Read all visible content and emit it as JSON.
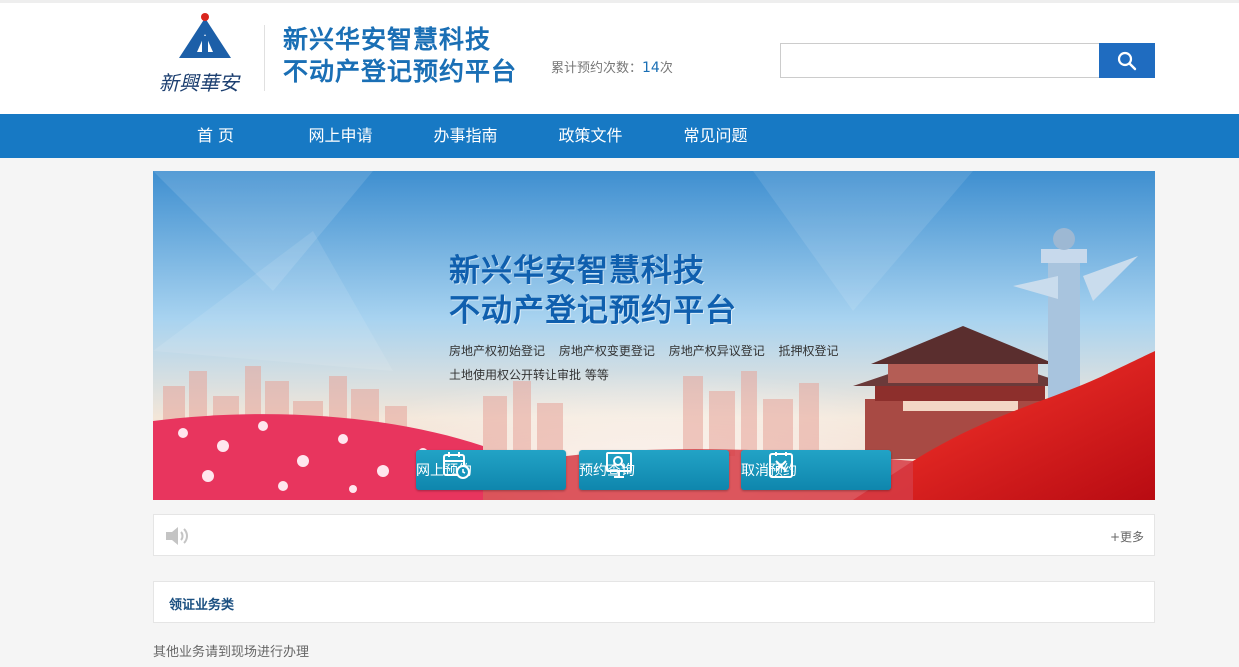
{
  "header": {
    "logo_text": "新興華安",
    "title_line1": "新兴华安智慧科技",
    "title_line2": "不动产登记预约平台",
    "counter_label": "累计预约次数：",
    "counter_value": "14",
    "counter_unit": "次",
    "search_value": ""
  },
  "nav": {
    "items": [
      "首 页",
      "网上申请",
      "办事指南",
      "政策文件",
      "常见问题"
    ]
  },
  "banner": {
    "title_line1": "新兴华安智慧科技",
    "title_line2": "不动产登记预约平台",
    "services": [
      "房地产权初始登记",
      "房地产权变更登记",
      "房地产权异议登记",
      "抵押权登记"
    ],
    "services_line2": "土地使用权公开转让审批 等等",
    "buttons": {
      "apply": "网上预约",
      "query": "预约查询",
      "cancel": "取消预约"
    }
  },
  "notice": {
    "more_label": "+更多"
  },
  "section": {
    "title": "领证业务类",
    "other_text": "其他业务请到现场进行办理"
  },
  "colors": {
    "brand_blue": "#1779c4",
    "title_blue": "#1a6fb5",
    "button_teal": "#1595bc"
  }
}
